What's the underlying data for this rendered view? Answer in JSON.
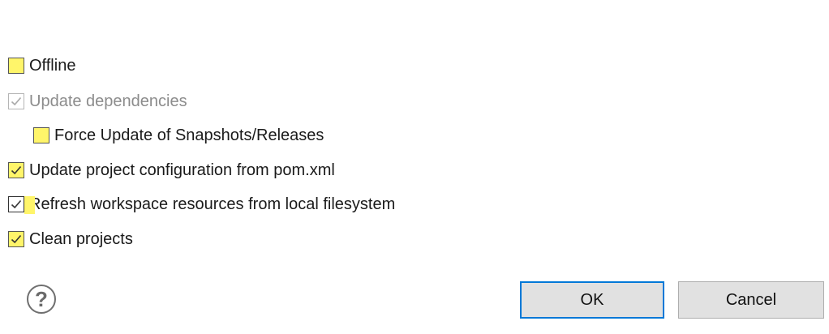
{
  "options": [
    {
      "label": "Offline",
      "checked": false,
      "disabled": false,
      "highlighted": true
    },
    {
      "label": "Update dependencies",
      "checked": true,
      "disabled": true,
      "highlighted": false
    },
    {
      "label": "Force Update of Snapshots/Releases",
      "checked": false,
      "disabled": false,
      "highlighted": true
    },
    {
      "label": "Update project configuration from pom.xml",
      "checked": true,
      "disabled": false,
      "highlighted": true
    },
    {
      "label": "Refresh workspace resources from local filesystem",
      "checked": true,
      "disabled": false,
      "highlighted": true
    },
    {
      "label": "Clean projects",
      "checked": true,
      "disabled": false,
      "highlighted": true
    }
  ],
  "help_icon": {
    "icon": "question-mark-icon",
    "symbol": "?"
  },
  "buttons": {
    "ok_label": "OK",
    "cancel_label": "Cancel"
  },
  "colors": {
    "highlight": "#fff56a",
    "focus_border": "#0078d7",
    "button_bg": "#e1e1e1",
    "disabled_text": "#8c8c8c"
  }
}
